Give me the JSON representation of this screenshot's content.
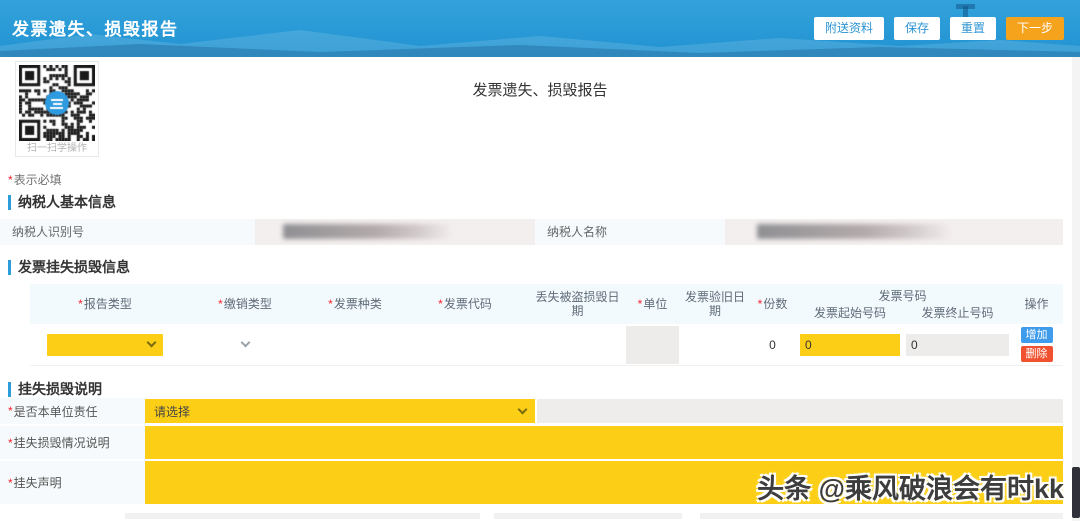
{
  "misc": {
    "required_mark": "*"
  },
  "colors": {
    "header_blue": "#2a99d5",
    "primary_orange": "#f5a21d",
    "field_yellow": "#fccf16",
    "add_button_blue": "#3f9beb",
    "delete_button_red": "#f0512f",
    "required_red": "#f5222d",
    "section_bar_blue": "#2d9cdb"
  },
  "header": {
    "title": "发票遗失、损毁报告",
    "buttons": [
      {
        "label": "附送资料"
      },
      {
        "label": "保存"
      },
      {
        "label": "重置"
      },
      {
        "label": "下一步"
      }
    ]
  },
  "qr": {
    "caption": "扫一扫学操作"
  },
  "content": {
    "page_title": "发票遗失、损毁报告",
    "required_note": "表示必填"
  },
  "taxpayer": {
    "section_title": "纳税人基本信息",
    "fields": [
      {
        "label": "纳税人识别号",
        "value_state": "blurred"
      },
      {
        "label": "纳税人名称",
        "value_state": "blurred"
      }
    ]
  },
  "invoice": {
    "section_title": "发票挂失损毁信息",
    "table": {
      "columns": [
        {
          "label": "报告类型",
          "required": true
        },
        {
          "label": "缴销类型",
          "required": true
        },
        {
          "label": "发票种类",
          "required": true
        },
        {
          "label": "发票代码",
          "required": true
        },
        {
          "label": "丢失被盗损毁日期",
          "required": false
        },
        {
          "label": "单位",
          "required": true
        },
        {
          "label": "发票验旧日期",
          "required": false
        },
        {
          "label": "份数",
          "required": true
        },
        {
          "label": "操作",
          "required": false
        }
      ],
      "group": {
        "label": "发票号码",
        "children": [
          {
            "label": "发票起始号码"
          },
          {
            "label": "发票终止号码"
          }
        ]
      },
      "row": {
        "copies": "0",
        "start_no": "0",
        "end_no": "0"
      },
      "actions": [
        {
          "label": "增加"
        },
        {
          "label": "删除"
        }
      ]
    }
  },
  "statement": {
    "section_title": "挂失损毁说明",
    "fields": [
      {
        "label": "是否本单位责任",
        "required": true,
        "value": "请选择"
      },
      {
        "label": "挂失损毁情况说明",
        "required": true,
        "value": ""
      },
      {
        "label": "挂失声明",
        "required": true,
        "value": ""
      }
    ]
  },
  "watermark": {
    "text": "头条 @乘风破浪会有时kk"
  }
}
